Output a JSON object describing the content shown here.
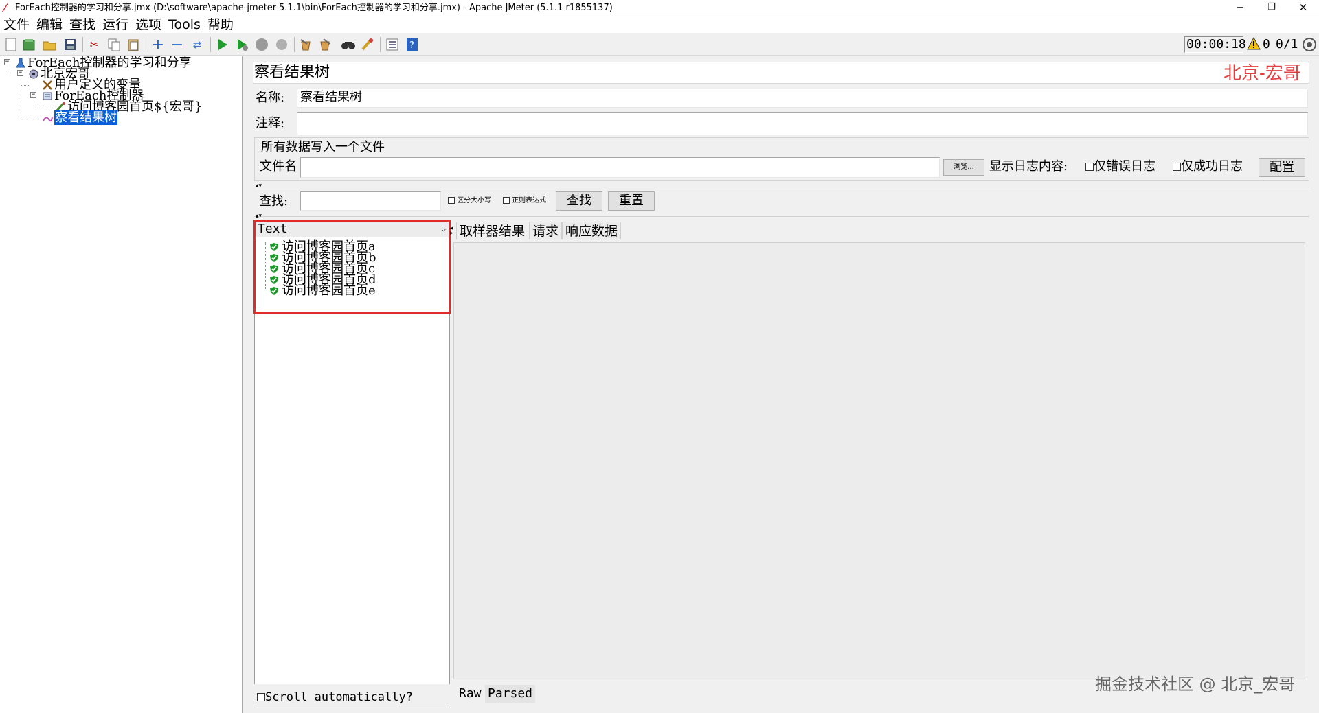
{
  "window": {
    "title": "ForEach控制器的学习和分享.jmx (D:\\software\\apache-jmeter-5.1.1\\bin\\ForEach控制器的学习和分享.jmx) - Apache JMeter (5.1.1 r1855137)",
    "minimize": "─",
    "restore": "❐",
    "close": "✕"
  },
  "menu": [
    "文件",
    "编辑",
    "查找",
    "运行",
    "选项",
    "Tools",
    "帮助"
  ],
  "toolbar": {
    "timer": "00:00:18",
    "warning_count": "0",
    "threads": "0/1"
  },
  "tree": {
    "root": "ForEach控制器的学习和分享",
    "thread_group": "北京宏哥",
    "user_vars": "用户定义的变量",
    "foreach": "ForEach控制器",
    "sampler": "访问博客园首页${宏哥}",
    "listener": "察看结果树"
  },
  "panel": {
    "title": "察看结果树",
    "watermark": "北京-宏哥",
    "name_label": "名称:",
    "name_value": "察看结果树",
    "comment_label": "注释:",
    "comment_value": "",
    "file_section": "所有数据写入一个文件",
    "filename_label": "文件名",
    "filename_value": "",
    "browse": "浏览...",
    "log_label": "显示日志内容:",
    "errors_only": "仅错误日志",
    "success_only": "仅成功日志",
    "configure": "配置",
    "search_label": "查找:",
    "search_value": "",
    "case_sensitive": "区分大小写",
    "regex": "正则表达式",
    "find": "查找",
    "reset": "重置"
  },
  "results": {
    "renderer": "Text",
    "samples": [
      "访问博客园首页a",
      "访问博客园首页b",
      "访问博客园首页c",
      "访问博客园首页d",
      "访问博客园首页e"
    ],
    "scroll_auto": "Scroll automatically?",
    "tabs": [
      "取样器结果",
      "请求",
      "响应数据"
    ],
    "bottom_tabs": [
      "Raw",
      "Parsed"
    ],
    "watermark": "掘金技术社区 @ 北京_宏哥"
  }
}
